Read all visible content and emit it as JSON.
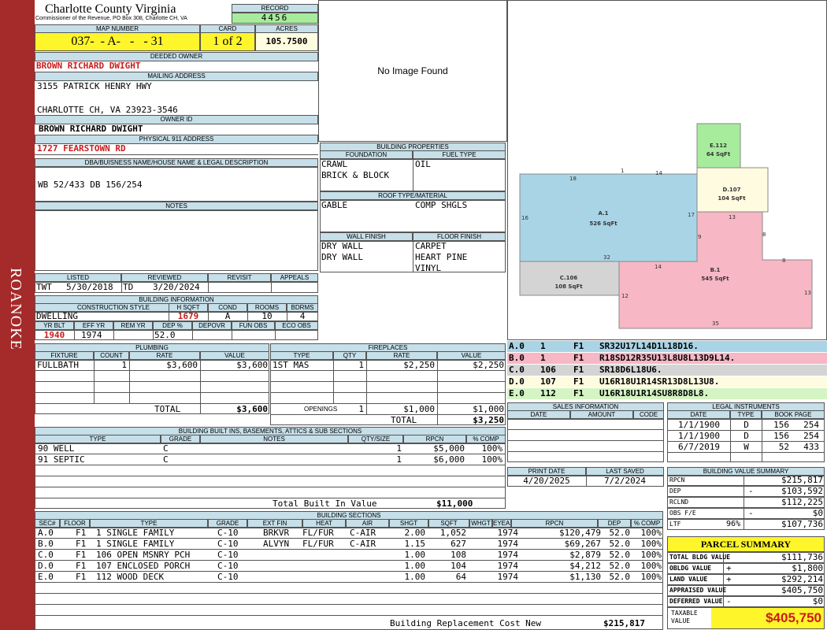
{
  "sidebar": {
    "label": "ROANOKE",
    "color": "#a52a2a"
  },
  "county": {
    "name": "Charlotte County Virginia",
    "sub": "Commissioner of the Revenue, PO Box 308, Charlotte CH, VA"
  },
  "record": {
    "label": "RECORD",
    "value": "4456"
  },
  "map": {
    "label": "MAP NUMBER",
    "value": "037-  - A-   -   - 31"
  },
  "card": {
    "label": "CARD",
    "value": "1 of 2"
  },
  "acres": {
    "label": "ACRES",
    "value": "105.7500"
  },
  "owner": {
    "deeded_label": "DEEDED OWNER",
    "deeded": "BROWN RICHARD DWIGHT",
    "mailing_label": "MAILING ADDRESS",
    "addr1": "3155 PATRICK HENRY HWY",
    "addr2": "CHARLOTTE CH, VA 23923-3546",
    "id_label": "OWNER ID",
    "id": "BROWN RICHARD DWIGHT",
    "phys_label": "PHYSICAL 911 ADDRESS",
    "phys": "1727 FEARSTOWN RD"
  },
  "dba": {
    "label": "DBA/BUISNESS NAME/HOUSE NAME & LEGAL DESCRIPTION",
    "value": "WB 52/433 DB 156/254"
  },
  "notes": {
    "label": "NOTES"
  },
  "image": {
    "text": "No Image Found"
  },
  "listed": {
    "h": [
      "LISTED",
      "REVIEWED",
      "REVISIT",
      "APPEALS"
    ],
    "listed_by": "TWT",
    "listed_date": "5/30/2018",
    "reviewed_by": "TD",
    "reviewed_date": "3/20/2024"
  },
  "building_info": {
    "label": "BUILDING INFORMATION",
    "h": [
      "CONSTRUCTION STYLE",
      "H SQFT",
      "COND",
      "ROOMS",
      "BDRMS"
    ],
    "style": "DWELLING",
    "hsqft": "1679",
    "cond": "A",
    "rooms": "10",
    "bdrms": "4",
    "h2": [
      "YR BLT",
      "EFF YR",
      "REM YR",
      "DEP %",
      "DEPOVR",
      "FUN OBS",
      "ECO OBS"
    ],
    "yrblt": "1940",
    "effyr": "1974",
    "remyr": "",
    "dep": "52.0"
  },
  "props": {
    "label": "BUILDING PROPERTIES",
    "foundation_label": "FOUNDATION",
    "fuel_label": "FUEL TYPE",
    "foundation": [
      "CRAWL",
      "BRICK & BLOCK"
    ],
    "fuel": [
      "OIL"
    ],
    "roof_label": "ROOF TYPE/MATERIAL",
    "roof": [
      "GABLE",
      "COMP SHGLS"
    ],
    "wall_label": "WALL FINISH",
    "floor_label": "FLOOR FINISH",
    "wall": [
      "DRY WALL",
      "DRY WALL"
    ],
    "floor": [
      "CARPET",
      "HEART PINE",
      "VINYL"
    ]
  },
  "sketch": {
    "areas": [
      {
        "id": "A.1",
        "sqft": "526 SqFt",
        "color": "#a9d4e6"
      },
      {
        "id": "B.1",
        "sqft": "545 SqFt",
        "color": "#f7b7c4"
      },
      {
        "id": "C.106",
        "sqft": "108 SqFt",
        "color": "#d4d4d4"
      },
      {
        "id": "D.107",
        "sqft": "104 SqFt",
        "color": "#fffbe0"
      },
      {
        "id": "E.112",
        "sqft": "64 SqFt",
        "color": "#a7ec9c"
      }
    ],
    "dims": [
      "18",
      "14",
      "1",
      "16",
      "17",
      "32",
      "14",
      "9",
      "13",
      "8",
      "8",
      "12",
      "35",
      "13"
    ]
  },
  "vectors": [
    {
      "sec": "A.0",
      "num": "1",
      "fl": "F1",
      "vec": "SR32U17L14D1L18D16.",
      "color": "#a9d4e6"
    },
    {
      "sec": "B.0",
      "num": "1",
      "fl": "F1",
      "vec": "R18SD12R35U13L8U8L13D9L14.",
      "color": "#f7b7c4"
    },
    {
      "sec": "C.0",
      "num": "106",
      "fl": "F1",
      "vec": "SR18D6L18U6.",
      "color": "#d4d4d4"
    },
    {
      "sec": "D.0",
      "num": "107",
      "fl": "F1",
      "vec": "U16R18U1R14SR13D8L13U8.",
      "color": "#fffbe0"
    },
    {
      "sec": "E.0",
      "num": "112",
      "fl": "F1",
      "vec": "U16R18U1R14SU8R8D8L8.",
      "color": "#d4f4c4"
    }
  ],
  "plumbing": {
    "label": "PLUMBING",
    "h": [
      "FIXTURE",
      "COUNT",
      "RATE",
      "VALUE"
    ],
    "rows": [
      {
        "fixture": "FULLBATH",
        "count": "1",
        "rate": "$3,600",
        "value": "$3,600"
      }
    ],
    "total_label": "TOTAL",
    "total": "$3,600"
  },
  "fireplaces": {
    "label": "FIREPLACES",
    "h": [
      "TYPE",
      "QTY",
      "RATE",
      "VALUE"
    ],
    "rows": [
      {
        "type": "1ST MAS",
        "qty": "1",
        "rate": "$2,250",
        "value": "$2,250"
      }
    ],
    "openings_label": "OPENINGS",
    "openings_qty": "1",
    "openings_rate": "$1,000",
    "openings_value": "$1,000",
    "total_label": "TOTAL",
    "total": "$3,250"
  },
  "sales": {
    "label": "SALES INFORMATION",
    "h": [
      "DATE",
      "AMOUNT",
      "CODE"
    ]
  },
  "legal": {
    "label": "LEGAL INSTRUMENTS",
    "h": [
      "DATE",
      "TYPE",
      "BOOK PAGE"
    ],
    "rows": [
      {
        "date": "1/1/1900",
        "type": "D",
        "book": "156",
        "page": "254"
      },
      {
        "date": "1/1/1900",
        "type": "D",
        "book": "156",
        "page": "254"
      },
      {
        "date": "6/7/2019",
        "type": "W",
        "book": "52",
        "page": "433"
      }
    ]
  },
  "builtins": {
    "label": "BUILDING BUILT INS, BASEMENTS, ATTICS & SUB SECTIONS",
    "h": [
      "TYPE",
      "GRADE",
      "NOTES",
      "QTY/SIZE",
      "RPCN",
      "% COMP"
    ],
    "rows": [
      {
        "type": "90 WELL",
        "grade": "C",
        "qty": "1",
        "rpcn": "$5,000",
        "pct": "100%"
      },
      {
        "type": "91 SEPTIC",
        "grade": "C",
        "qty": "1",
        "rpcn": "$6,000",
        "pct": "100%"
      }
    ],
    "total_label": "Total Built In Value",
    "total": "$11,000"
  },
  "dates": {
    "h": [
      "PRINT DATE",
      "LAST SAVED"
    ],
    "print": "4/20/2025",
    "saved": "7/2/2024"
  },
  "value_summary": {
    "label": "BUILDING VALUE SUMMARY",
    "rows": [
      {
        "k": "RPCN",
        "op": "",
        "v": "$215,817"
      },
      {
        "k": "DEP",
        "op": "-",
        "v": "$103,592"
      },
      {
        "k": "RCLND",
        "op": "",
        "v": "$112,225"
      },
      {
        "k": "OBS F/E",
        "op": "-",
        "v": "$0"
      },
      {
        "k": "LTF",
        "pct": "96%",
        "op": "",
        "v": "$107,736"
      }
    ]
  },
  "parcel": {
    "label": "PARCEL SUMMARY",
    "rows": [
      {
        "k": "TOTAL BLDG VALUE",
        "op": "",
        "v": "$111,736"
      },
      {
        "k": "OBLDG VALUE",
        "op": "+",
        "v": "$1,800"
      },
      {
        "k": "LAND VALUE",
        "op": "+",
        "v": "$292,214"
      },
      {
        "k": "APPRAISED VALUE",
        "op": "",
        "v": "$405,750"
      },
      {
        "k": "DEFERRED VALUE",
        "op": "-",
        "v": "$0"
      }
    ],
    "taxable_label": "TAXABLE VALUE",
    "taxable": "$405,750"
  },
  "sections": {
    "label": "BUILDING SECTIONS",
    "h": [
      "SEC#",
      "FLOOR",
      "TYPE",
      "GRADE",
      "EXT FIN",
      "HEAT",
      "AIR",
      "SHGT",
      "SQFT",
      "WHGT",
      "EYEAR",
      "RPCN",
      "DEP",
      "% COMP"
    ],
    "rows": [
      {
        "sec": "A.0",
        "floor": "F1",
        "type": "1 SINGLE FAMILY",
        "grade": "C-10",
        "ext": "BRKVR",
        "heat": "FL/FUR",
        "air": "C-AIR",
        "shgt": "2.00",
        "sqft": "1,052",
        "eyear": "1974",
        "rpcn": "$120,479",
        "dep": "52.0",
        "pct": "100%"
      },
      {
        "sec": "B.0",
        "floor": "F1",
        "type": "1 SINGLE FAMILY",
        "grade": "C-10",
        "ext": "ALVYN",
        "heat": "FL/FUR",
        "air": "C-AIR",
        "shgt": "1.15",
        "sqft": "627",
        "eyear": "1974",
        "rpcn": "$69,267",
        "dep": "52.0",
        "pct": "100%"
      },
      {
        "sec": "C.0",
        "floor": "F1",
        "type": "106 OPEN MSNRY PCH",
        "grade": "C-10",
        "ext": "",
        "heat": "",
        "air": "",
        "shgt": "1.00",
        "sqft": "108",
        "eyear": "1974",
        "rpcn": "$2,879",
        "dep": "52.0",
        "pct": "100%"
      },
      {
        "sec": "D.0",
        "floor": "F1",
        "type": "107 ENCLOSED PORCH",
        "grade": "C-10",
        "ext": "",
        "heat": "",
        "air": "",
        "shgt": "1.00",
        "sqft": "104",
        "eyear": "1974",
        "rpcn": "$4,212",
        "dep": "52.0",
        "pct": "100%"
      },
      {
        "sec": "E.0",
        "floor": "F1",
        "type": "112 WOOD DECK",
        "grade": "C-10",
        "ext": "",
        "heat": "",
        "air": "",
        "shgt": "1.00",
        "sqft": "64",
        "eyear": "1974",
        "rpcn": "$1,130",
        "dep": "52.0",
        "pct": "100%"
      }
    ],
    "total_label": "Building Replacement Cost New",
    "total": "$215,817"
  }
}
